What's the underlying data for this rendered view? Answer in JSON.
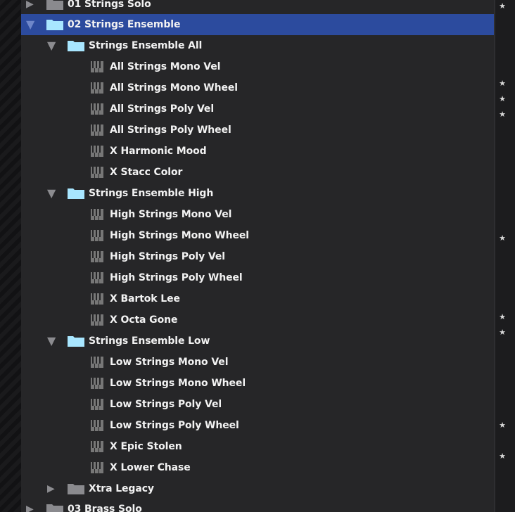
{
  "tree": {
    "top_folder_1": {
      "label": "01 Strings Solo",
      "expanded": false
    },
    "top_folder_2": {
      "label": "02 Strings Ensemble",
      "expanded": true,
      "selected": true
    },
    "group_all": {
      "label": "Strings Ensemble All",
      "items": [
        "All Strings Mono Vel",
        "All Strings Mono Wheel",
        "All Strings Poly Vel",
        "All Strings Poly Wheel",
        "X Harmonic Mood",
        "X Stacc Color"
      ]
    },
    "group_high": {
      "label": "Strings Ensemble High",
      "items": [
        "High Strings Mono Vel",
        "High Strings Mono Wheel",
        "High Strings Poly Vel",
        "High Strings Poly Wheel",
        "X Bartok Lee",
        "X Octa Gone"
      ]
    },
    "group_low": {
      "label": "Strings Ensemble Low",
      "items": [
        "Low Strings Mono Vel",
        "Low Strings Mono Wheel",
        "Low Strings Poly Vel",
        "Low Strings Poly Wheel",
        "X Epic Stolen",
        "X Lower Chase"
      ]
    },
    "legacy": {
      "label": "Xtra Legacy",
      "expanded": false
    },
    "top_folder_3": {
      "label": "03 Brass Solo",
      "expanded": false
    }
  },
  "favorites": {
    "star_glyph": "★",
    "starred_count": 10
  },
  "colors": {
    "selection": "#2c4b9e",
    "folder_open": "#a8e6ff",
    "folder_closed": "#8a8a8e",
    "text": "#f2f2f2"
  }
}
